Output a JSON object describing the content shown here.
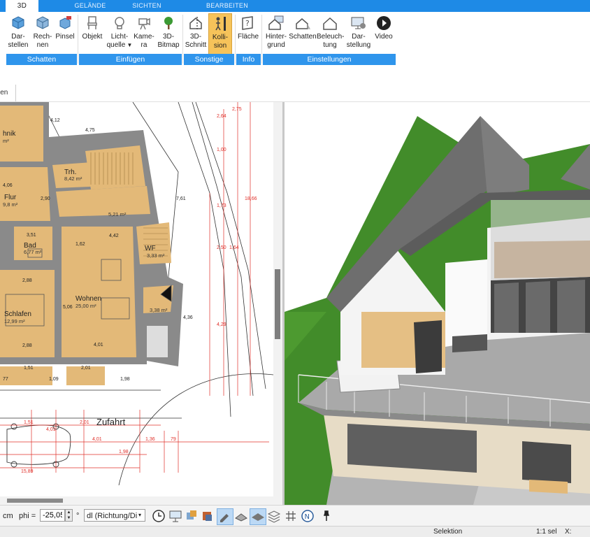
{
  "tabs": [
    {
      "label": "3D",
      "active": true
    },
    {
      "label": "GELÄNDE"
    },
    {
      "label": "SICHTEN"
    },
    {
      "label": "BEARBEITEN"
    }
  ],
  "ribbon": {
    "groups": {
      "schatten": "Schatten",
      "einfuegen": "Einfügen",
      "sonstige": "Sonstige",
      "info": "Info",
      "einstellungen": "Einstellungen"
    },
    "buttons": {
      "darstellen": [
        "Dar-",
        "stellen"
      ],
      "rechnen": [
        "Rech-",
        "nen"
      ],
      "pinsel": [
        "Pinsel",
        ""
      ],
      "objekt": [
        "Objekt",
        ""
      ],
      "lichtquelle": [
        "Licht-",
        "quelle"
      ],
      "kamera": [
        "Kame-",
        "ra"
      ],
      "bitmap": [
        "3D-",
        "Bitmap"
      ],
      "schnitt": [
        "3D-",
        "Schnitt"
      ],
      "kollision": [
        "Kolli-",
        "sion"
      ],
      "flaeche": [
        "Fläche",
        ""
      ],
      "hintergrund": [
        "Hinter-",
        "grund"
      ],
      "schatten": [
        "Schatten",
        ""
      ],
      "beleuchtung": [
        "Beleuch-",
        "tung"
      ],
      "darstellung": [
        "Dar-",
        "stellung"
      ],
      "video": [
        "Video",
        ""
      ]
    }
  },
  "doc_tab": "ien",
  "plan": {
    "rooms": [
      {
        "name": "hnik",
        "area": "m²"
      },
      {
        "name": "Trh.",
        "area": "8,42 m²"
      },
      {
        "name": "Flur",
        "area": "9,8 m²"
      },
      {
        "name": "Bad",
        "area": "6,77 m²"
      },
      {
        "name": "WF",
        "area": "3,33 m²"
      },
      {
        "name": "Schlafen",
        "area": "12,99 m²"
      },
      {
        "name": "Wohnen",
        "area": "25,00 m²"
      }
    ],
    "extra_area": "3,38 m²",
    "stair_area": "5,21 m²",
    "zufahrt": "Zufahrt",
    "dims": [
      "4,75",
      "4,12",
      "4,06",
      "2,90",
      "3,51",
      "4,42",
      "1,62",
      "2,88",
      "5,06",
      "4,01",
      "2,88",
      "1,51",
      "2,01",
      "1,09",
      "1,98",
      "77",
      "4,36",
      "7,61",
      "2,64",
      "1,00",
      "1,73",
      "2,50",
      "1,64",
      "4,29",
      "2,75",
      "18,66",
      "1,51",
      "2,01",
      "1,36",
      "79",
      "4,01",
      "1,98",
      "15,89",
      "4,01"
    ]
  },
  "toolbar": {
    "unit": "cm",
    "phi_label": "phi =",
    "phi_value": "-25,05",
    "degree": "°",
    "dl_value": "dl (Richtung/Di"
  },
  "status": {
    "mode": "Selektion",
    "scale": "1:1 sel",
    "x_label": "X:"
  },
  "colors": {
    "tab_bar": "#1e8ae6",
    "group_label": "#2f95ec",
    "active_button": "#f6c35a",
    "room_fill": "#e3b978",
    "wall": "#7f7f7f",
    "dimension": "#e0302a",
    "grass": "#3f8a26",
    "roof": "#6e6e6e"
  }
}
